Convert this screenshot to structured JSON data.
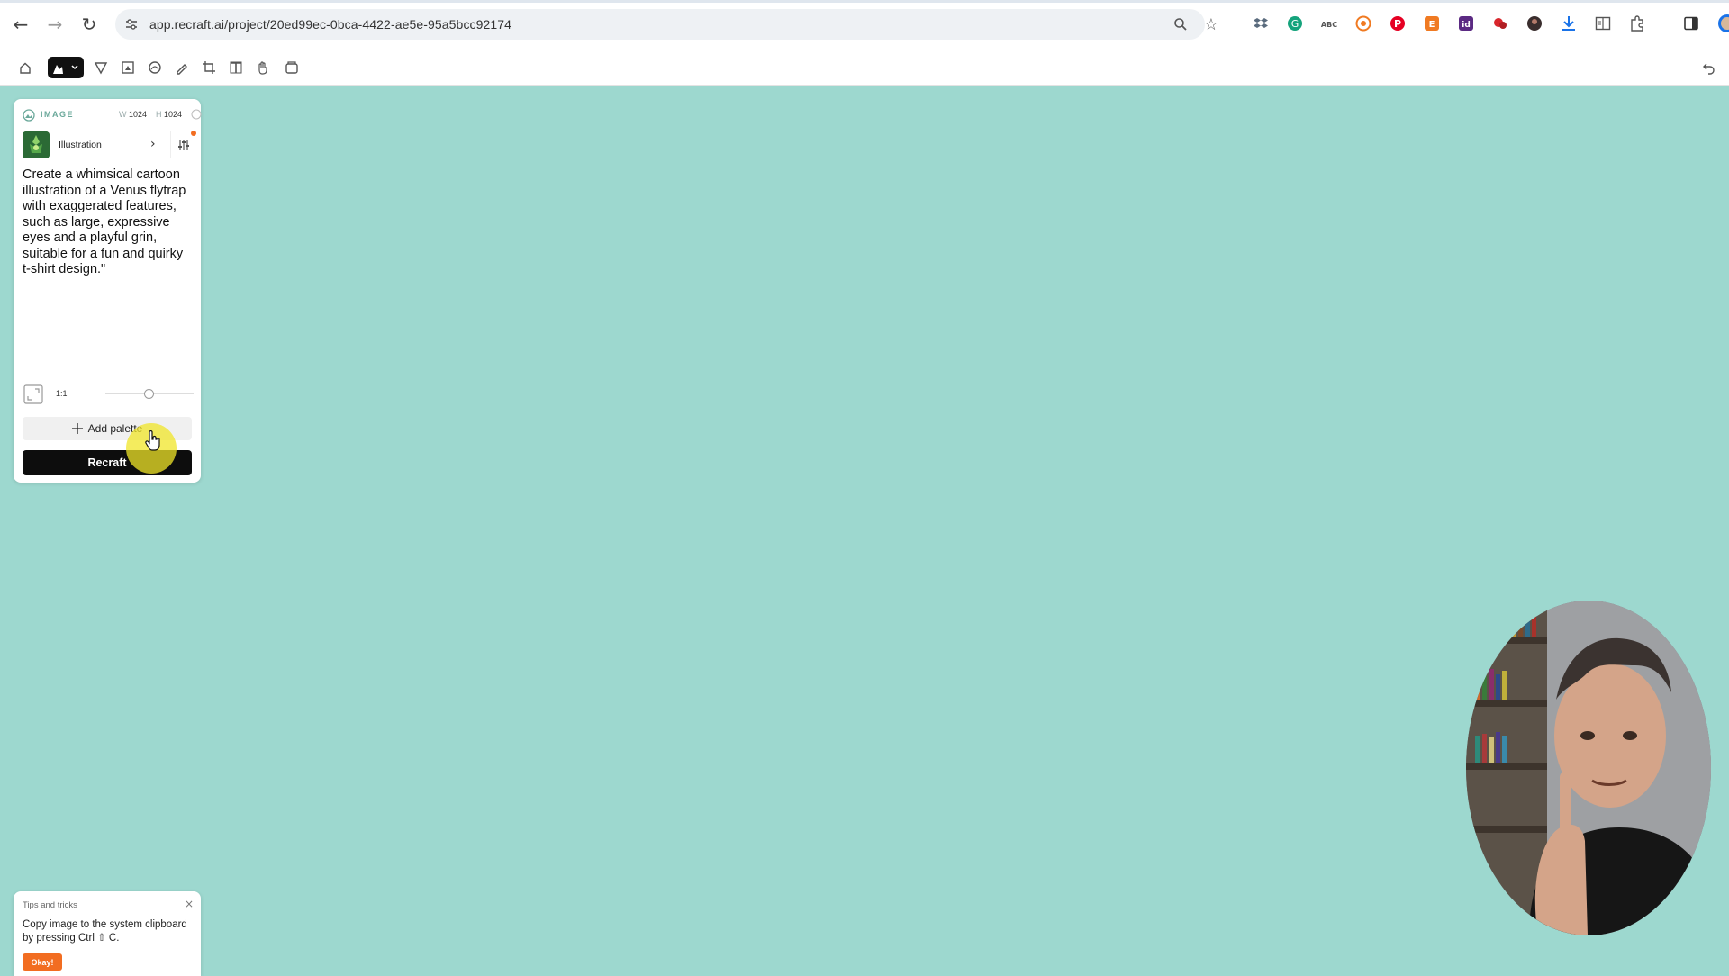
{
  "browser": {
    "url": "app.recraft.ai/project/20ed99ec-0bca-4422-ae5e-95a5bcc92174",
    "nav_icons": [
      "back-arrow-icon",
      "forward-arrow-icon",
      "reload-icon"
    ],
    "url_icons": [
      "site-settings-icon",
      "zoom-icon",
      "bookmark-star-icon"
    ],
    "extension_icons": [
      "dropbox-icon",
      "grammarly-icon",
      "aiprm-icon",
      "extension-icon",
      "pinterest-icon",
      "extension-icon",
      "extension-icon",
      "extension-icon",
      "extension-icon",
      "download-icon",
      "reader-icon",
      "puzzle-icon",
      "side-panel-icon",
      "profile-avatar-icon"
    ]
  },
  "toolbar": {
    "tools": [
      "home-icon",
      "image-tool-icon",
      "vector-tool-icon",
      "frame-tool-icon",
      "mockup-tool-icon",
      "pen-tool-icon",
      "crop-tool-icon",
      "text-tool-icon",
      "hand-tool-icon",
      "gallery-icon"
    ],
    "undo_icon": "undo-icon"
  },
  "panel": {
    "type_label": "IMAGE",
    "width_label": "W",
    "width_value": "1024",
    "height_label": "H",
    "height_value": "1024",
    "style_name": "Illustration",
    "prompt": "Create a whimsical cartoon illustration of a Venus flytrap with exaggerated features, such as large, expressive eyes and a playful grin, suitable for a fun and quirky t-shirt design.\"",
    "aspect_ratio": "1:1",
    "add_palette_label": "Add palette",
    "recraft_label": "Recraft"
  },
  "tips": {
    "title": "Tips and tricks",
    "text": "Copy image to the system clipboard by pressing Ctrl ⇧ C.",
    "button": "Okay!"
  },
  "colors": {
    "canvas": "#9dd8cf",
    "accent": "#f26d21",
    "primary_button": "#0d0d0d"
  }
}
